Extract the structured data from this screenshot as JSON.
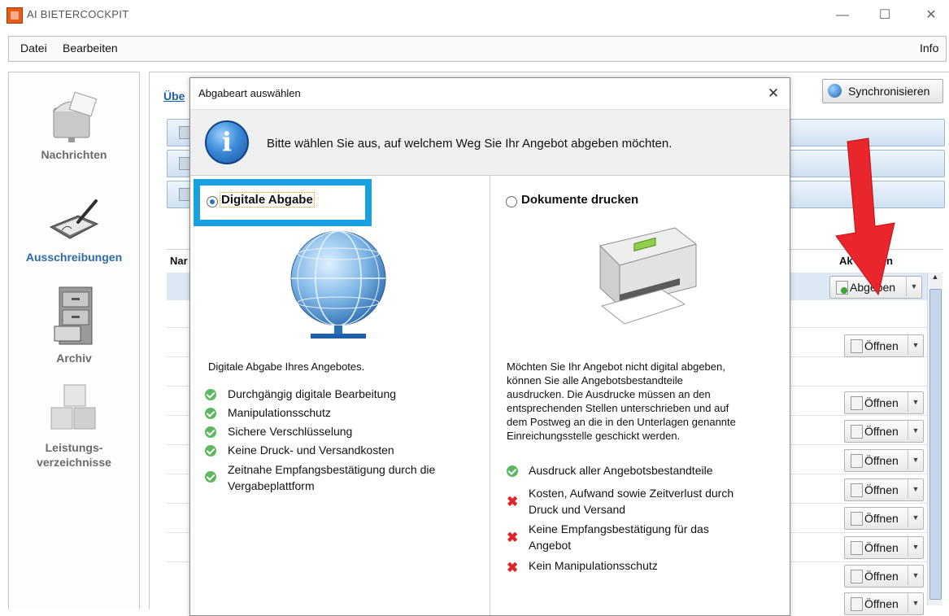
{
  "window": {
    "title": "AI BIETERCOCKPIT",
    "minimize": "—",
    "maximize": "☐",
    "close": "✕"
  },
  "menu": {
    "datei": "Datei",
    "bearbeiten": "Bearbeiten",
    "info": "Info"
  },
  "nav": {
    "items": [
      {
        "label": "Nachrichten",
        "icon": "mailbox-icon"
      },
      {
        "label": "Ausschreibungen",
        "icon": "signature-pad-icon"
      },
      {
        "label": "Archiv",
        "icon": "filing-cabinet-icon"
      },
      {
        "label_line1": "Leistungs-",
        "label_line2": "verzeichnisse",
        "icon": "cubes-icon"
      }
    ]
  },
  "main": {
    "tab": "Übe",
    "sync_label": "Synchronisieren",
    "col_name": "Nar",
    "col_actions": "Ak",
    "col_actions_tail": "n",
    "actions": [
      {
        "label": "Abgeben",
        "style": "green"
      },
      {
        "label": "Öffnen"
      },
      {
        "label": "Öffnen"
      },
      {
        "label": "Öffnen"
      },
      {
        "label": "Öffnen"
      },
      {
        "label": "Öffnen"
      },
      {
        "label": "Öffnen"
      },
      {
        "label": "Öffnen"
      },
      {
        "label": "Öffnen"
      },
      {
        "label": "Öffnen"
      }
    ]
  },
  "dialog": {
    "title": "Abgabeart auswählen",
    "close": "✕",
    "intro": "Bitte wählen Sie aus, auf welchem Weg Sie Ihr Angebot abgeben möchten.",
    "digital": {
      "label": "Digitale Abgabe",
      "description": "Digitale Abgabe Ihres Angebotes.",
      "features": [
        "Durchgängig digitale Bearbeitung",
        "Manipulationsschutz",
        "Sichere Verschlüsselung",
        "Keine Druck- und Versandkosten"
      ],
      "feature_long_1": "Zeitnahe Empfangsbestätigung durch die",
      "feature_long_2": "Vergabeplattform"
    },
    "print": {
      "label": "Dokumente drucken",
      "desc_lines": [
        "Möchten Sie Ihr Angebot nicht digital abgeben,",
        "können Sie alle Angebotsbestandteile",
        "ausdrucken. Die Ausdrucke müssen an den",
        "entsprechenden Stellen unterschrieben und auf",
        "dem Postweg an die in den Unterlagen genannte",
        "Einreichungsstelle geschickt werden."
      ],
      "pro": "Ausdruck aller Angebotsbestandteile",
      "con1_a": "Kosten, Aufwand sowie Zeitverlust durch",
      "con1_b": "Druck und Versand",
      "con2_a": "Keine Empfangsbestätigung für das",
      "con2_b": "Angebot",
      "con3": "Kein Manipulationsschutz"
    }
  },
  "colors": {
    "highlight_frame": "#19a0e1",
    "arrow": "#e8262b",
    "check": "#5cb85c",
    "cross": "#e0242a"
  }
}
